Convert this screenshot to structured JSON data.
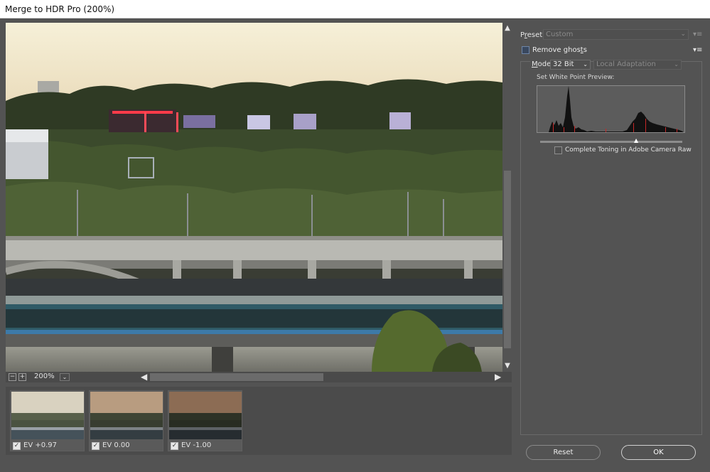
{
  "window": {
    "title": "Merge to HDR Pro (200%)"
  },
  "preview": {
    "zoom": "200%"
  },
  "thumbnails": [
    {
      "label": "EV +0.97",
      "checked": true
    },
    {
      "label": "EV 0.00",
      "checked": true
    },
    {
      "label": "EV -1.00",
      "checked": true
    }
  ],
  "panel": {
    "preset_label_pre": "P",
    "preset_label_u": "r",
    "preset_label_post": "eset:",
    "preset_value": "Custom",
    "remove_ghosts_pre": "Remove ghos",
    "remove_ghosts_u": "t",
    "remove_ghosts_post": "s",
    "mode_label_u": "M",
    "mode_label_post": "ode:",
    "mode_value": "32 Bit",
    "method_value": "Local Adaptation",
    "white_point_label": "Set White Point Preview:",
    "complete_toning_label": "Complete Toning in Adobe Camera Raw"
  },
  "buttons": {
    "reset": "Reset",
    "ok": "OK"
  },
  "colors": {
    "background": "#535353",
    "accent_checkbox": "#39485f"
  }
}
